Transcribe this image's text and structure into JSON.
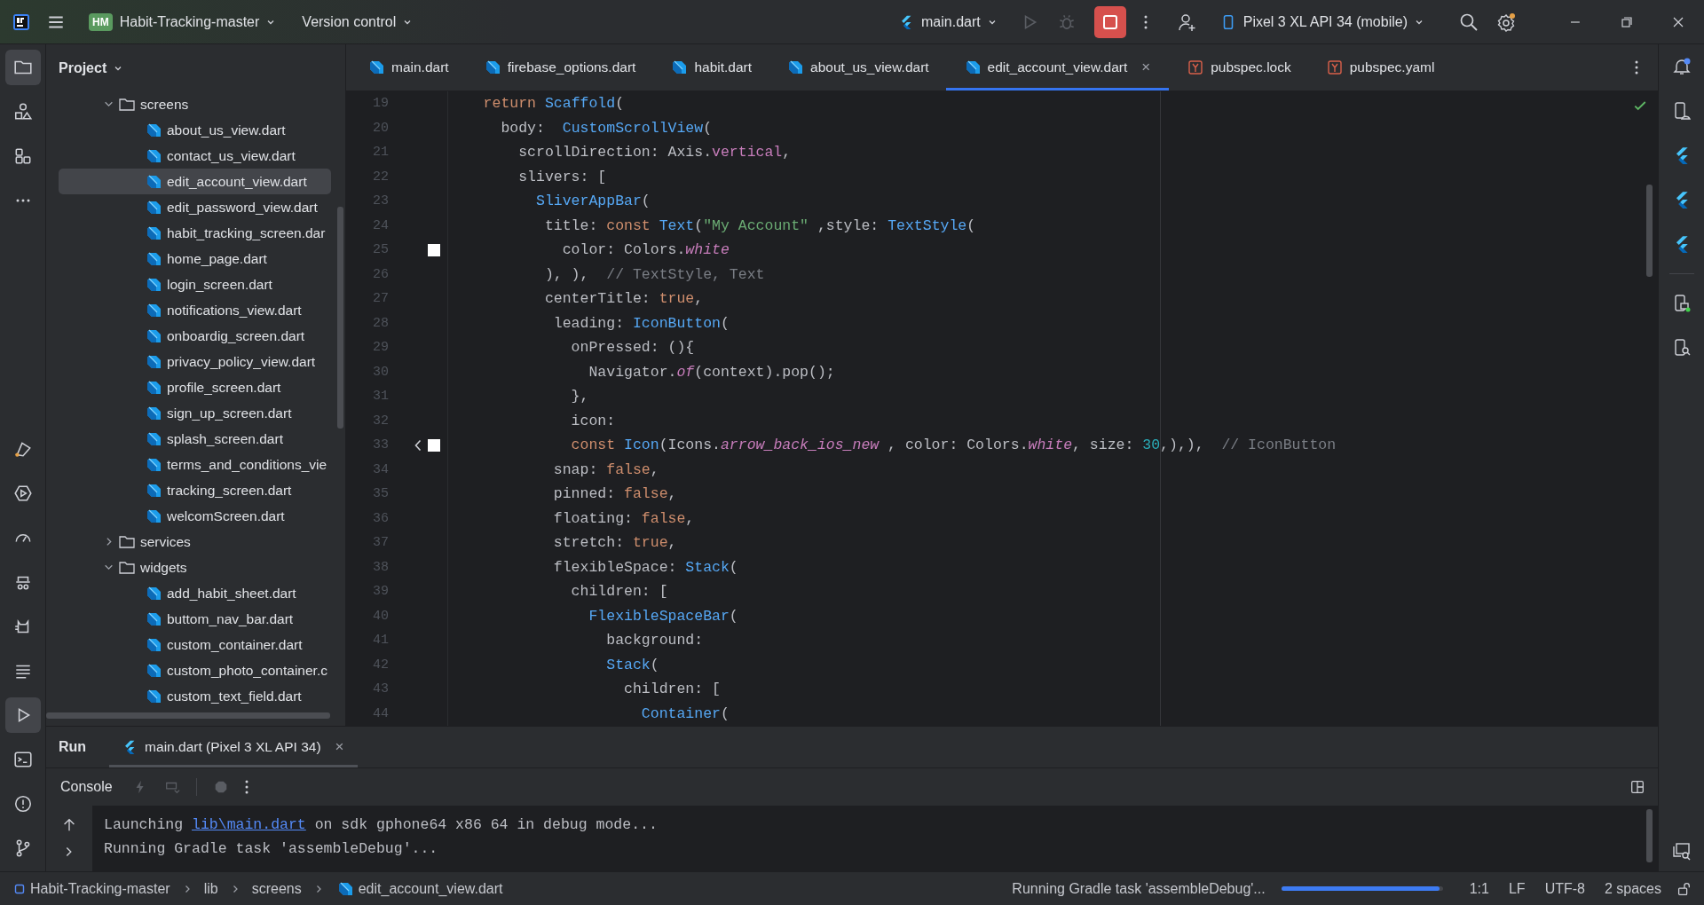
{
  "top_bar": {
    "project_badge": "HM",
    "project": "Habit-Tracking-master",
    "vcs": "Version control",
    "run_config": "main.dart",
    "device": "Pixel 3 XL API 34 (mobile)",
    "settings_notice": true
  },
  "project_panel": {
    "title": "Project",
    "tree": [
      {
        "kind": "folder",
        "label": "screens",
        "expanded": true,
        "selected": false,
        "children": [
          {
            "kind": "file",
            "label": "about_us_view.dart",
            "selected": false
          },
          {
            "kind": "file",
            "label": "contact_us_view.dart",
            "selected": false
          },
          {
            "kind": "file",
            "label": "edit_account_view.dart",
            "selected": true
          },
          {
            "kind": "file",
            "label": "edit_password_view.dart",
            "selected": false
          },
          {
            "kind": "file",
            "label": "habit_tracking_screen.dar",
            "selected": false
          },
          {
            "kind": "file",
            "label": "home_page.dart",
            "selected": false
          },
          {
            "kind": "file",
            "label": "login_screen.dart",
            "selected": false
          },
          {
            "kind": "file",
            "label": "notifications_view.dart",
            "selected": false
          },
          {
            "kind": "file",
            "label": "onboardig_screen.dart",
            "selected": false
          },
          {
            "kind": "file",
            "label": "privacy_policy_view.dart",
            "selected": false
          },
          {
            "kind": "file",
            "label": "profile_screen.dart",
            "selected": false
          },
          {
            "kind": "file",
            "label": "sign_up_screen.dart",
            "selected": false
          },
          {
            "kind": "file",
            "label": "splash_screen.dart",
            "selected": false
          },
          {
            "kind": "file",
            "label": "terms_and_conditions_vie",
            "selected": false
          },
          {
            "kind": "file",
            "label": "tracking_screen.dart",
            "selected": false
          },
          {
            "kind": "file",
            "label": "welcomScreen.dart",
            "selected": false
          }
        ]
      },
      {
        "kind": "folder",
        "label": "services",
        "expanded": false,
        "selected": false
      },
      {
        "kind": "folder",
        "label": "widgets",
        "expanded": true,
        "selected": false,
        "children": [
          {
            "kind": "file",
            "label": "add_habit_sheet.dart",
            "selected": false
          },
          {
            "kind": "file",
            "label": "buttom_nav_bar.dart",
            "selected": false
          },
          {
            "kind": "file",
            "label": "custom_container.dart",
            "selected": false
          },
          {
            "kind": "file",
            "label": "custom_photo_container.c",
            "selected": false
          },
          {
            "kind": "file",
            "label": "custom_text_field.dart",
            "selected": false
          }
        ]
      }
    ]
  },
  "tabs": [
    {
      "kind": "dart",
      "label": "main.dart",
      "selected": false
    },
    {
      "kind": "dart",
      "label": "firebase_options.dart",
      "selected": false
    },
    {
      "kind": "dart",
      "label": "habit.dart",
      "selected": false
    },
    {
      "kind": "dart",
      "label": "about_us_view.dart",
      "selected": false
    },
    {
      "kind": "dart",
      "label": "edit_account_view.dart",
      "selected": true,
      "close": "×"
    },
    {
      "kind": "yaml",
      "label": "pubspec.lock",
      "selected": false
    },
    {
      "kind": "yaml",
      "label": "pubspec.yaml",
      "selected": false
    }
  ],
  "editor": {
    "lines": [
      {
        "number": "19",
        "tokens": [
          {
            "kind": "kw",
            "text": "    return"
          },
          {
            "kind": "type",
            "text": " Scaffold"
          },
          {
            "kind": "plain",
            "text": "("
          }
        ]
      },
      {
        "number": "20",
        "tokens": [
          {
            "kind": "plain",
            "text": "      body:  "
          },
          {
            "kind": "type",
            "text": "CustomScrollView"
          },
          {
            "kind": "plain",
            "text": "("
          }
        ]
      },
      {
        "number": "21",
        "tokens": [
          {
            "kind": "plain",
            "text": "        scrollDirection: Axis."
          },
          {
            "kind": "prop",
            "text": "vertical"
          },
          {
            "kind": "plain",
            "text": ","
          }
        ]
      },
      {
        "number": "22",
        "tokens": [
          {
            "kind": "plain",
            "text": "        slivers: ["
          }
        ]
      },
      {
        "number": "23",
        "tokens": [
          {
            "kind": "type",
            "text": "          SliverAppBar"
          },
          {
            "kind": "plain",
            "text": "("
          }
        ]
      },
      {
        "number": "24",
        "tokens": [
          {
            "kind": "plain",
            "text": "           title: "
          },
          {
            "kind": "kw",
            "text": "const"
          },
          {
            "kind": "type",
            "text": " Text"
          },
          {
            "kind": "plain",
            "text": "("
          },
          {
            "kind": "str",
            "text": "\"My Account\""
          },
          {
            "kind": "plain",
            "text": " ,style: "
          },
          {
            "kind": "type",
            "text": "TextStyle"
          },
          {
            "kind": "plain",
            "text": "("
          }
        ]
      },
      {
        "number": "25",
        "swatch": true,
        "tokens": [
          {
            "kind": "plain",
            "text": "             color: Colors."
          },
          {
            "kind": "italic",
            "text": "white"
          }
        ]
      },
      {
        "number": "26",
        "tokens": [
          {
            "kind": "plain",
            "text": "           ), ),  "
          },
          {
            "kind": "comment",
            "text": "// TextStyle, Text"
          }
        ]
      },
      {
        "number": "27",
        "tokens": [
          {
            "kind": "plain",
            "text": "           centerTitle: "
          },
          {
            "kind": "kw",
            "text": "true"
          },
          {
            "kind": "plain",
            "text": ","
          }
        ]
      },
      {
        "number": "28",
        "tokens": [
          {
            "kind": "plain",
            "text": "            leading: "
          },
          {
            "kind": "type",
            "text": "IconButton"
          },
          {
            "kind": "plain",
            "text": "("
          }
        ]
      },
      {
        "number": "29",
        "tokens": [
          {
            "kind": "plain",
            "text": "              onPressed: (){"
          }
        ]
      },
      {
        "number": "30",
        "tokens": [
          {
            "kind": "plain",
            "text": "                Navigator."
          },
          {
            "kind": "italic",
            "text": "of"
          },
          {
            "kind": "plain",
            "text": "(context).pop();"
          }
        ]
      },
      {
        "number": "31",
        "tokens": [
          {
            "kind": "plain",
            "text": "              },"
          }
        ]
      },
      {
        "number": "32",
        "tokens": [
          {
            "kind": "plain",
            "text": "              icon:"
          }
        ]
      },
      {
        "number": "33",
        "swatch": true,
        "icon_preview": true,
        "tokens": [
          {
            "kind": "kw",
            "text": "              const"
          },
          {
            "kind": "type",
            "text": " Icon"
          },
          {
            "kind": "plain",
            "text": "(Icons."
          },
          {
            "kind": "italic",
            "text": "arrow_back_ios_new"
          },
          {
            "kind": "plain",
            "text": " , color: Colors."
          },
          {
            "kind": "italic",
            "text": "white"
          },
          {
            "kind": "plain",
            "text": ", size: "
          },
          {
            "kind": "num",
            "text": "30"
          },
          {
            "kind": "plain",
            "text": ",),),  "
          },
          {
            "kind": "comment",
            "text": "// IconButton"
          }
        ]
      },
      {
        "number": "34",
        "tokens": [
          {
            "kind": "plain",
            "text": "            snap: "
          },
          {
            "kind": "kw",
            "text": "false"
          },
          {
            "kind": "plain",
            "text": ","
          }
        ]
      },
      {
        "number": "35",
        "tokens": [
          {
            "kind": "plain",
            "text": "            pinned: "
          },
          {
            "kind": "kw",
            "text": "false"
          },
          {
            "kind": "plain",
            "text": ","
          }
        ]
      },
      {
        "number": "36",
        "tokens": [
          {
            "kind": "plain",
            "text": "            floating: "
          },
          {
            "kind": "kw",
            "text": "false"
          },
          {
            "kind": "plain",
            "text": ","
          }
        ]
      },
      {
        "number": "37",
        "tokens": [
          {
            "kind": "plain",
            "text": "            stretch: "
          },
          {
            "kind": "kw",
            "text": "true"
          },
          {
            "kind": "plain",
            "text": ","
          }
        ]
      },
      {
        "number": "38",
        "tokens": [
          {
            "kind": "plain",
            "text": "            flexibleSpace: "
          },
          {
            "kind": "type",
            "text": "Stack"
          },
          {
            "kind": "plain",
            "text": "("
          }
        ]
      },
      {
        "number": "39",
        "tokens": [
          {
            "kind": "plain",
            "text": "              children: ["
          }
        ]
      },
      {
        "number": "40",
        "tokens": [
          {
            "kind": "type",
            "text": "                FlexibleSpaceBar"
          },
          {
            "kind": "plain",
            "text": "("
          }
        ]
      },
      {
        "number": "41",
        "tokens": [
          {
            "kind": "plain",
            "text": "                  background:"
          }
        ]
      },
      {
        "number": "42",
        "tokens": [
          {
            "kind": "type",
            "text": "                  Stack"
          },
          {
            "kind": "plain",
            "text": "("
          }
        ]
      },
      {
        "number": "43",
        "tokens": [
          {
            "kind": "plain",
            "text": "                    children: ["
          }
        ]
      },
      {
        "number": "44",
        "tokens": [
          {
            "kind": "type",
            "text": "                      Container"
          },
          {
            "kind": "plain",
            "text": "("
          }
        ]
      }
    ]
  },
  "run_panel": {
    "title": "Run",
    "tabs": [
      {
        "label": "main.dart (Pixel 3 XL API 34)",
        "selected": true,
        "close": "×"
      }
    ],
    "console_label": "Console",
    "output": [
      {
        "parts": [
          {
            "kind": "text",
            "text": "Launching "
          },
          {
            "kind": "link",
            "text": "lib\\main.dart"
          },
          {
            "kind": "text",
            "text": " on sdk gphone64 x86 64 in debug mode..."
          }
        ]
      },
      {
        "parts": [
          {
            "kind": "text",
            "text": "Running Gradle task 'assembleDebug'..."
          }
        ]
      }
    ]
  },
  "status_bar": {
    "breadcrumbs": [
      {
        "kind": "module",
        "label": "Habit-Tracking-master"
      },
      {
        "kind": "folder",
        "label": "lib"
      },
      {
        "kind": "folder",
        "label": "screens"
      },
      {
        "kind": "dart",
        "label": "edit_account_view.dart"
      }
    ],
    "task": "Running Gradle task 'assembleDebug'...",
    "progress": {
      "level": 0.98
    },
    "position": "1:1",
    "line_ending": "LF",
    "encoding": "UTF-8",
    "indent": "2 spaces"
  }
}
